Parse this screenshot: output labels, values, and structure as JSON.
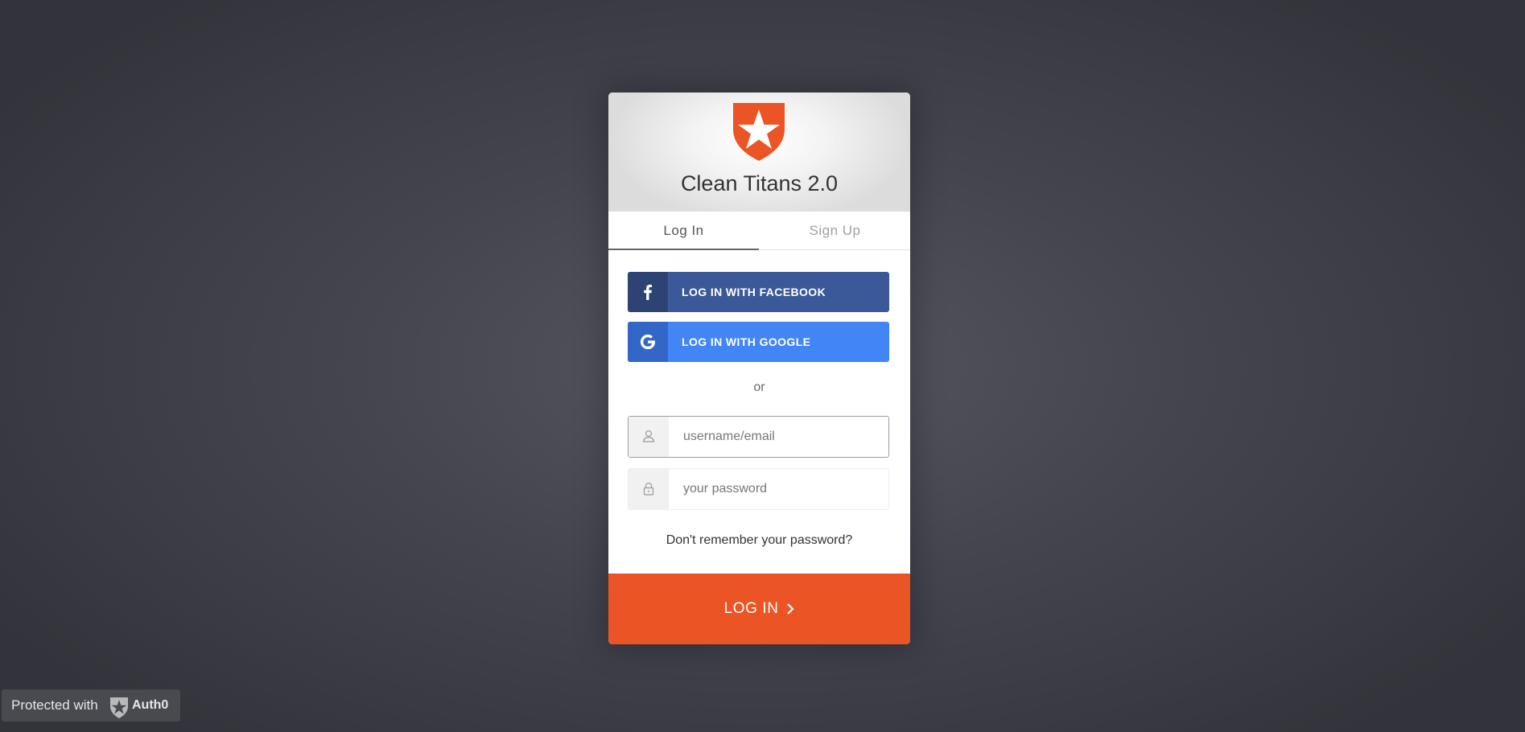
{
  "app": {
    "title": "Clean Titans 2.0",
    "logo_icon": "auth0-shield-star-icon",
    "brand_color": "#eb5424"
  },
  "tabs": [
    {
      "label": "Log In",
      "active": true
    },
    {
      "label": "Sign Up",
      "active": false
    }
  ],
  "social": {
    "facebook": {
      "label": "LOG IN WITH FACEBOOK",
      "icon": "facebook-icon",
      "color": "#3b5998"
    },
    "google": {
      "label": "LOG IN WITH GOOGLE",
      "icon": "google-icon",
      "color": "#4285f4"
    }
  },
  "separator": "or",
  "form": {
    "username": {
      "placeholder": "username/email",
      "value": "",
      "icon": "user-icon"
    },
    "password": {
      "placeholder": "your password",
      "value": "",
      "icon": "lock-icon"
    },
    "forgot_label": "Don't remember your password?",
    "submit_label": "LOG IN"
  },
  "footer": {
    "protected_label": "Protected with",
    "brand_name": "Auth0"
  }
}
